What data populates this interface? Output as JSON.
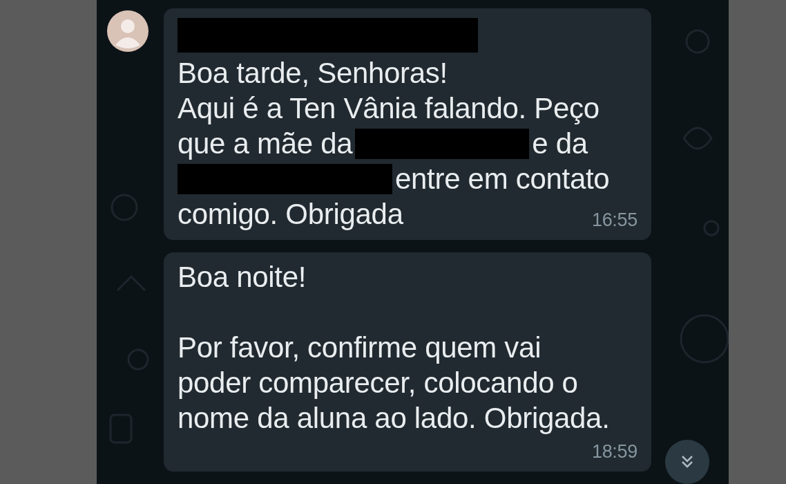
{
  "messages": [
    {
      "sender": [
        {
          "kind": "redacted"
        }
      ],
      "lines": [
        [
          {
            "kind": "text",
            "text": "Boa tarde, Senhoras!"
          }
        ],
        [
          {
            "kind": "text",
            "text": "Aqui é a Ten Vânia falando. Peço"
          }
        ],
        [
          {
            "kind": "text",
            "text": "que a mãe da"
          },
          {
            "kind": "redacted"
          },
          {
            "kind": "text",
            "text": "e da"
          }
        ],
        [
          {
            "kind": "redacted"
          },
          {
            "kind": "text",
            "text": "entre em contato"
          }
        ],
        [
          {
            "kind": "text",
            "text": "comigo. Obrigada"
          }
        ]
      ],
      "time": "16:55"
    },
    {
      "lines": [
        [
          {
            "kind": "text",
            "text": "Boa noite!"
          }
        ],
        [
          {
            "kind": "blank"
          }
        ],
        [
          {
            "kind": "text",
            "text": "Por favor, confirme quem vai"
          }
        ],
        [
          {
            "kind": "text",
            "text": "poder comparecer, colocando o"
          }
        ],
        [
          {
            "kind": "text",
            "text": "nome da aluna ao lado. Obrigada."
          }
        ]
      ],
      "time": "18:59"
    }
  ]
}
